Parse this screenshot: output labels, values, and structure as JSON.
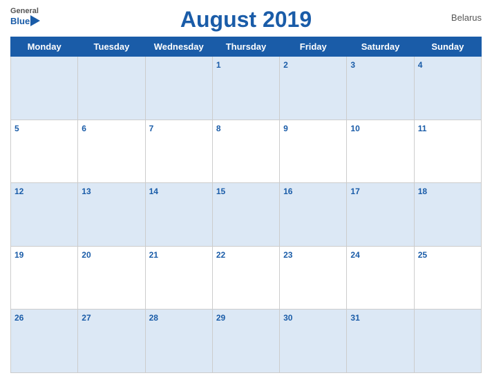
{
  "header": {
    "title": "August 2019",
    "country": "Belarus",
    "logo": {
      "general": "General",
      "blue": "Blue"
    }
  },
  "calendar": {
    "days_of_week": [
      "Monday",
      "Tuesday",
      "Wednesday",
      "Thursday",
      "Friday",
      "Saturday",
      "Sunday"
    ],
    "weeks": [
      [
        null,
        null,
        null,
        1,
        2,
        3,
        4
      ],
      [
        5,
        6,
        7,
        8,
        9,
        10,
        11
      ],
      [
        12,
        13,
        14,
        15,
        16,
        17,
        18
      ],
      [
        19,
        20,
        21,
        22,
        23,
        24,
        25
      ],
      [
        26,
        27,
        28,
        29,
        30,
        31,
        null
      ]
    ]
  }
}
